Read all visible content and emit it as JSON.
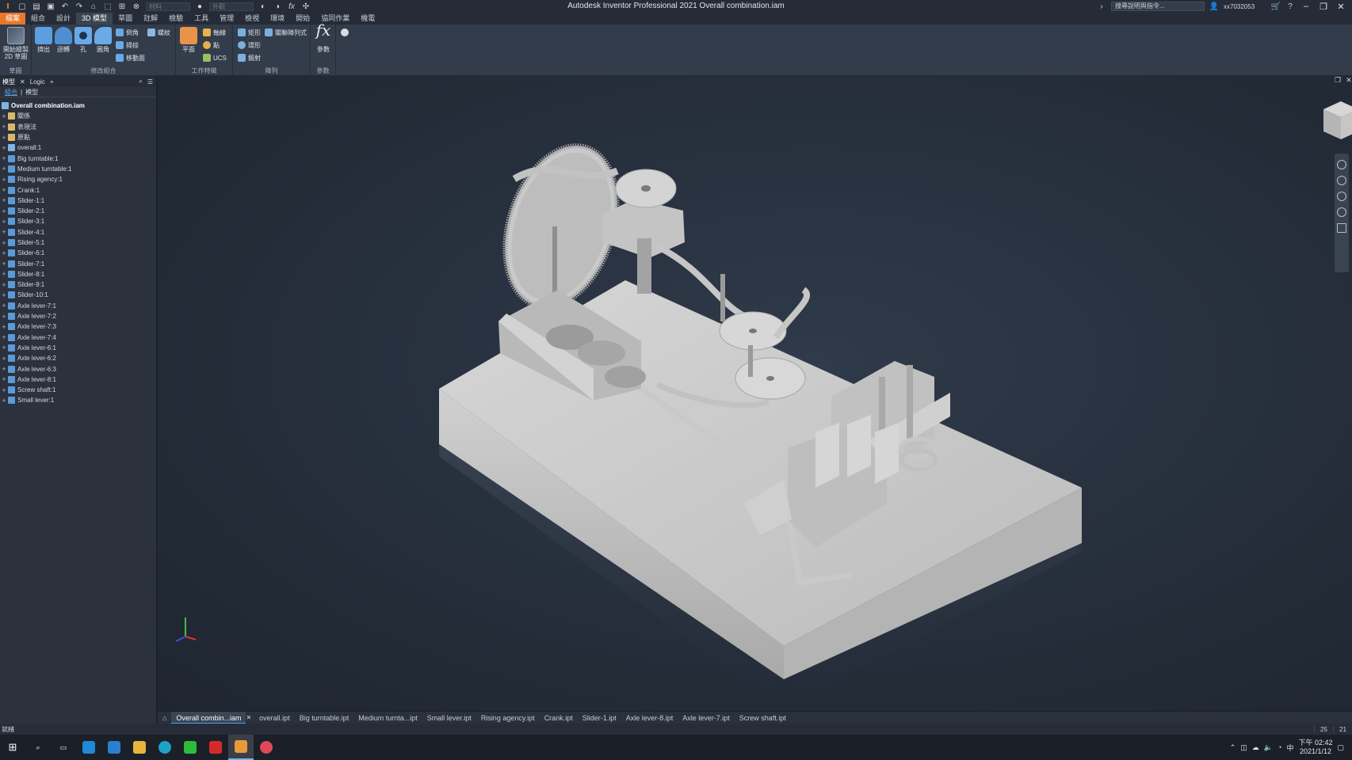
{
  "window": {
    "title": "Autodesk Inventor Professional 2021   Overall combination.iam",
    "search_placeholder": "搜尋說明與指令...",
    "user": "xx7032053",
    "quick_input_1": "材料",
    "quick_input_2": "外觀"
  },
  "ribbon_tabs": [
    "檔案",
    "組合",
    "設計",
    "3D 模型",
    "草圖",
    "註解",
    "檢驗",
    "工具",
    "管理",
    "檢視",
    "環境",
    "開始",
    "協同作業",
    "機電"
  ],
  "ribbon": {
    "sketch_group": {
      "button": "開始繪製\n2D 草圖",
      "label": "草圖"
    },
    "modify_group": {
      "extrude": "擠出",
      "revolve": "迴轉",
      "hole": "孔",
      "fillet": "圓角",
      "chamfer": "倒角",
      "sweep": "掃掠",
      "move_face": "移動面",
      "label": "修改組合"
    },
    "thread": "螺紋",
    "work_group": {
      "plane": "平面",
      "axis": "軸線",
      "point": "點",
      "ucs": "UCS",
      "label": "工作特徵"
    },
    "pattern_group": {
      "rect": "矩形",
      "circular": "環形",
      "mirror": "鏡射",
      "pattern_component": "關聯陣列式",
      "label": "陣列"
    },
    "param_group": {
      "params": "參數",
      "label": "參數"
    }
  },
  "browser": {
    "tabs": [
      "模型",
      "Logic"
    ],
    "subtabs": [
      "組合",
      "模型"
    ],
    "root": "Overall combination.iam",
    "items": [
      {
        "label": "關係",
        "icon": "folder"
      },
      {
        "label": "表現法",
        "icon": "folder"
      },
      {
        "label": "原點",
        "icon": "folder"
      },
      {
        "label": "overall:1",
        "icon": "asm"
      },
      {
        "label": "Big turntable:1",
        "icon": "part"
      },
      {
        "label": "Medium turntable:1",
        "icon": "part"
      },
      {
        "label": "Rising agency:1",
        "icon": "part"
      },
      {
        "label": "Crank:1",
        "icon": "part"
      },
      {
        "label": "Slider-1:1",
        "icon": "part"
      },
      {
        "label": "Slider-2:1",
        "icon": "part"
      },
      {
        "label": "Slider-3:1",
        "icon": "part"
      },
      {
        "label": "Slider-4:1",
        "icon": "part"
      },
      {
        "label": "Slider-5:1",
        "icon": "part"
      },
      {
        "label": "Slider-6:1",
        "icon": "part"
      },
      {
        "label": "Slider-7:1",
        "icon": "part"
      },
      {
        "label": "Slider-8:1",
        "icon": "part"
      },
      {
        "label": "Slider-9:1",
        "icon": "part"
      },
      {
        "label": "Slider-10:1",
        "icon": "part"
      },
      {
        "label": "Axle lever-7:1",
        "icon": "part"
      },
      {
        "label": "Axle lever-7:2",
        "icon": "part"
      },
      {
        "label": "Axle lever-7:3",
        "icon": "part"
      },
      {
        "label": "Axle lever-7:4",
        "icon": "part"
      },
      {
        "label": "Axle lever-6:1",
        "icon": "part"
      },
      {
        "label": "Axle lever-6:2",
        "icon": "part"
      },
      {
        "label": "Axle lever-6:3",
        "icon": "part"
      },
      {
        "label": "Axle lever-8:1",
        "icon": "part"
      },
      {
        "label": "Screw shaft:1",
        "icon": "part"
      },
      {
        "label": "Small lever:1",
        "icon": "part"
      }
    ]
  },
  "doc_tabs": [
    "Overall combin...iam",
    "overall.ipt",
    "Big turntable.ipt",
    "Medium turnta...ipt",
    "Small lever.ipt",
    "Rising agency.ipt",
    "Crank.ipt",
    "Slider-1.ipt",
    "Axle lever-8.ipt",
    "Axle lever-7.ipt",
    "Screw shaft.ipt"
  ],
  "status": {
    "text": "就緒",
    "count1": "25",
    "count2": "21"
  },
  "clock": {
    "time": "下午 02:42",
    "date": "2021/1/12"
  },
  "tray_ime": "中"
}
